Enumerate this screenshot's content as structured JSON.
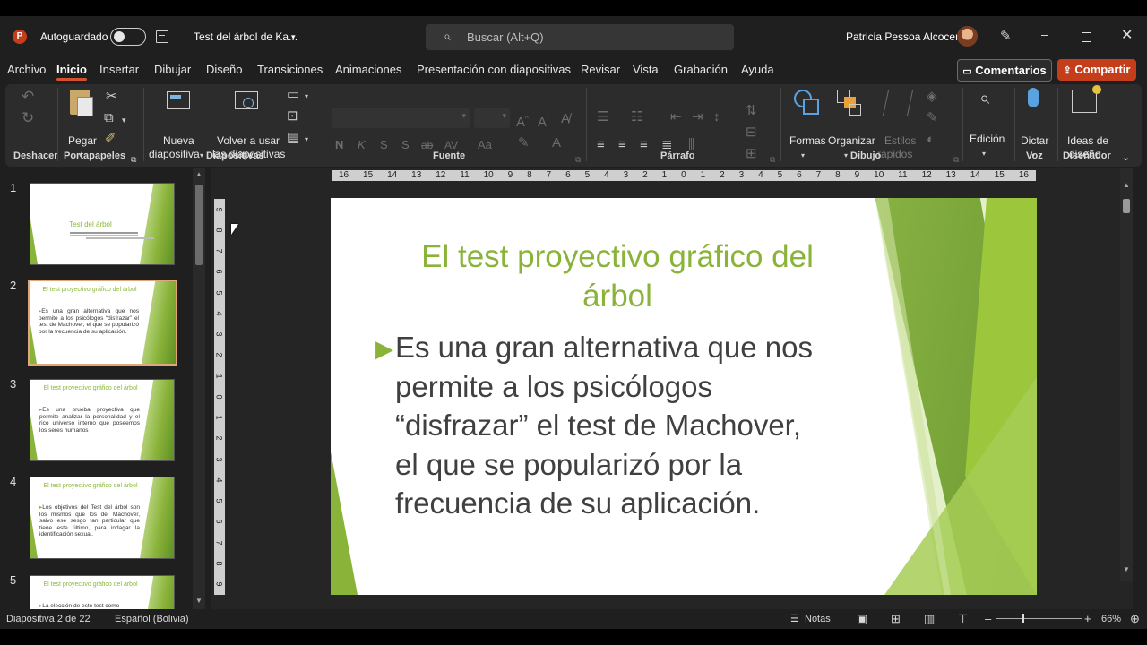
{
  "titlebar": {
    "autosave_label": "Autoguardado",
    "doc_title": "Test del árbol de Ka...",
    "search_placeholder": "Buscar (Alt+Q)",
    "user_name": "Patricia Pessoa Alcocer"
  },
  "menu": {
    "items": [
      "Archivo",
      "Inicio",
      "Insertar",
      "Dibujar",
      "Diseño",
      "Transiciones",
      "Animaciones",
      "Presentación con diapositivas",
      "Revisar",
      "Vista",
      "Grabación",
      "Ayuda"
    ],
    "active": "Inicio",
    "comments_label": "Comentarios",
    "share_label": "Compartir"
  },
  "ribbon": {
    "groups": {
      "undo": "Deshacer",
      "clipboard": "Portapapeles",
      "slides": "Diapositivas",
      "font": "Fuente",
      "paragraph": "Párrafo",
      "drawing": "Dibujo",
      "voice": "Voz",
      "designer": "Diseñador"
    },
    "paste": "Pegar",
    "new_slide_1": "Nueva",
    "new_slide_2": "diapositiva",
    "reuse_1": "Volver a usar",
    "reuse_2": "las diapositivas",
    "font_bold": "N",
    "font_italic": "K",
    "font_underline": "S",
    "font_strike": "S",
    "font_case": "Aa",
    "shapes": "Formas",
    "arrange": "Organizar",
    "quick_styles_1": "Estilos",
    "quick_styles_2": "rápidos",
    "editing": "Edición",
    "dictate": "Dictar",
    "design_ideas_1": "Ideas de",
    "design_ideas_2": "diseño"
  },
  "thumbnails": [
    {
      "num": "1",
      "title": "Test del árbol",
      "body": ""
    },
    {
      "num": "2",
      "title": "El test proyectivo gráfico del árbol",
      "body": "Es una gran alternativa que nos permite a los psicólogos “disfrazar” el test de Machover, el que se popularizó por la frecuencia de su aplicación."
    },
    {
      "num": "3",
      "title": "El test proyectivo gráfico del árbol",
      "body": "Es una prueba proyectiva que permite analizar la personalidad y el rico universo interno que poseemos los seres humanos"
    },
    {
      "num": "4",
      "title": "El test proyectivo gráfico del árbol",
      "body": "Los objetivos del Test del árbol son los mismos que los del Machover, salvo ese sesgo tan particular que tiene este último, para indagar la identificación sexual."
    },
    {
      "num": "5",
      "title": "El test proyectivo gráfico del árbol",
      "body": "La elección de este test como"
    }
  ],
  "slide": {
    "title_line1": "El test proyectivo gráfico del",
    "title_line2": "árbol",
    "body_line1": "Es una gran alternativa que nos",
    "body_line2": "permite a los psicólogos",
    "body_line3": "“disfrazar” el test de Machover,",
    "body_line4": "el que se popularizó por la",
    "body_line5": "frecuencia de su aplicación."
  },
  "ruler": {
    "h_ticks": [
      "16",
      "15",
      "14",
      "13",
      "12",
      "11",
      "10",
      "9",
      "8",
      "7",
      "6",
      "5",
      "4",
      "3",
      "2",
      "1",
      "0",
      "1",
      "2",
      "3",
      "4",
      "5",
      "6",
      "7",
      "8",
      "9",
      "10",
      "11",
      "12",
      "13",
      "14",
      "15",
      "16"
    ],
    "v_ticks": [
      "9",
      "8",
      "7",
      "6",
      "5",
      "4",
      "3",
      "2",
      "1",
      "0",
      "1",
      "2",
      "3",
      "4",
      "5",
      "6",
      "7",
      "8",
      "9"
    ]
  },
  "status": {
    "slide_counter": "Diapositiva 2 de 22",
    "language": "Español (Bolivia)",
    "notes": "Notas",
    "zoom": "66%"
  },
  "colors": {
    "accent": "#d35230",
    "share": "#c43e1c",
    "slide_green": "#8ab33a",
    "slide_text": "#404040"
  }
}
